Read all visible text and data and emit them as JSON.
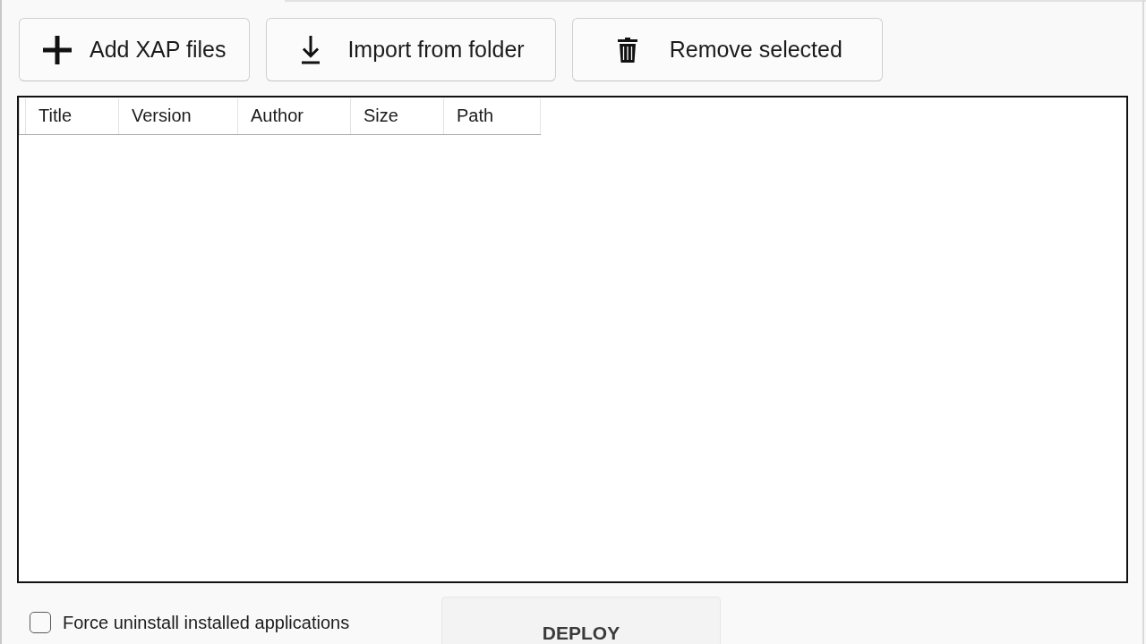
{
  "toolbar": {
    "buttons": [
      {
        "kind": "add",
        "label": "Add XAP files"
      },
      {
        "kind": "import",
        "label": "Import from folder"
      },
      {
        "kind": "remove",
        "label": "Remove selected"
      }
    ]
  },
  "table": {
    "columns": [
      "Title",
      "Version",
      "Author",
      "Size",
      "Path"
    ]
  },
  "options": {
    "force_uninstall": {
      "label": "Force uninstall installed applications",
      "checked": false
    }
  },
  "deploy_button": {
    "label": "DEPLOY"
  }
}
